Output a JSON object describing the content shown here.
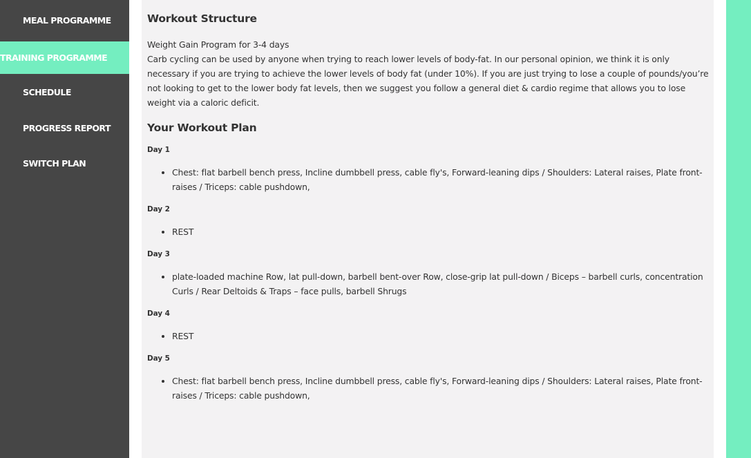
{
  "sidebar": {
    "items": [
      {
        "label": "MEAL PROGRAMME",
        "active": false
      },
      {
        "label": "TRAINING PROGRAMME",
        "active": true
      },
      {
        "label": "SCHEDULE",
        "active": false
      },
      {
        "label": "PROGRESS REPORT",
        "active": false
      },
      {
        "label": "SWITCH PLAN",
        "active": false
      }
    ]
  },
  "main": {
    "title": "Workout Structure",
    "intro": {
      "subtitle": "Weight Gain Program for 3-4 days",
      "body": "Carb cycling can be used by anyone when trying to reach lower levels of body-fat. In our personal opinion, we think it is only necessary if you are trying to achieve the lower levels of body fat (under 10%). If you are just trying to lose a couple of pounds/you’re not looking to get to the lower body fat levels, then we suggest you follow a general diet & cardio regime that allows you to lose weight via a caloric deficit."
    },
    "plan_title": "Your Workout Plan",
    "days": [
      {
        "label": "Day 1",
        "items": [
          "Chest: flat barbell bench press, Incline dumbbell press, cable fly's, Forward-leaning dips / Shoulders: Lateral raises, Plate front-raises / Triceps: cable pushdown,"
        ]
      },
      {
        "label": "Day 2",
        "items": [
          "REST"
        ]
      },
      {
        "label": "Day 3",
        "items": [
          "plate-loaded machine Row, lat pull-down, barbell bent-over Row, close-grip lat pull-down / Biceps – barbell curls, concentration Curls / Rear Deltoids & Traps – face pulls, barbell Shrugs"
        ]
      },
      {
        "label": "Day 4",
        "items": [
          "REST"
        ]
      },
      {
        "label": "Day 5",
        "items": [
          "Chest: flat barbell bench press, Incline dumbbell press, cable fly's, Forward-leaning dips / Shoulders: Lateral raises, Plate front-raises / Triceps: cable pushdown,"
        ]
      }
    ]
  },
  "colors": {
    "sidebar_bg": "#464646",
    "accent": "#74eec0",
    "content_bg": "#f3f2f3",
    "text": "#333333"
  }
}
